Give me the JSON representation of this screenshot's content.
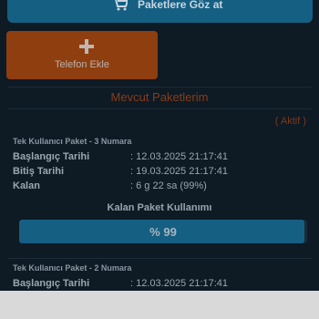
{
  "top_button": {
    "label": "Paketlere Göz at",
    "icon": "cart-icon"
  },
  "add_phone": {
    "label": "Telefon Ekle",
    "icon": "plus-icon"
  },
  "section": {
    "title": "Mevcut Paketlerim"
  },
  "packages": [
    {
      "status": "( Aktif )",
      "name": "Tek Kullanıcı Paket - 3 Numara",
      "start_label": "Başlangıç Tarihi",
      "start_value": ": 12.03.2025 21:17:41",
      "end_label": "Bitiş Tarihi",
      "end_value": ": 19.03.2025 21:17:41",
      "remaining_label": "Kalan",
      "remaining_value": ": 6 g 22 sa (99%)",
      "usage_title": "Kalan Paket Kullanımı",
      "usage_text": "% 99",
      "usage_percent": 99
    },
    {
      "name": "Tek Kullanıcı Paket - 2 Numara",
      "start_label": "Başlangıç Tarihi",
      "start_value": ": 12.03.2025 21:17:41"
    }
  ],
  "colors": {
    "background": "#0e1a24",
    "primary": "#155f82",
    "accent": "#8f3e0f"
  }
}
